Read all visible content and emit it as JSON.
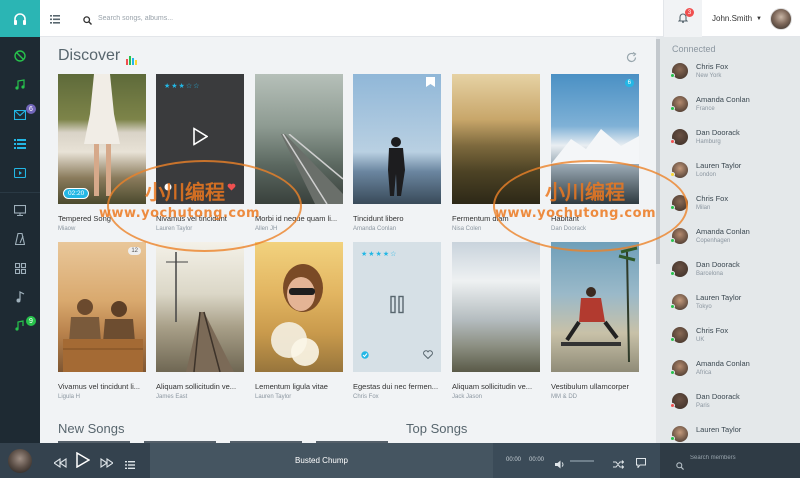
{
  "app": {
    "user_name": "John.Smith",
    "notification_count": "3",
    "search_placeholder": "Search songs, albums..."
  },
  "rail": {
    "items": [
      {
        "icon": "disc-icon",
        "badge": ""
      },
      {
        "icon": "music-note-icon",
        "badge": ""
      },
      {
        "icon": "mail-icon",
        "badge": "6"
      },
      {
        "icon": "list-icon",
        "badge": ""
      },
      {
        "icon": "video-icon",
        "badge": ""
      },
      {
        "icon": "monitor-icon",
        "badge": ""
      },
      {
        "icon": "metronome-icon",
        "badge": ""
      },
      {
        "icon": "grid-icon",
        "badge": ""
      },
      {
        "icon": "note-icon",
        "badge": ""
      },
      {
        "icon": "download-music-icon",
        "badge": "9"
      }
    ]
  },
  "main": {
    "title": "Discover",
    "cards": [
      {
        "title": "Tempered Song",
        "artist": "Miaow",
        "pill": "02:20",
        "badge": "",
        "stars": ""
      },
      {
        "title": "Nivamus vel tincidunt",
        "artist": "Lauren Taylor",
        "pill": "",
        "badge": "",
        "stars": "★★★☆☆"
      },
      {
        "title": "Morbi id neque quam li...",
        "artist": "Allen JH",
        "pill": "",
        "badge": "",
        "stars": ""
      },
      {
        "title": "Tincidunt libero",
        "artist": "Amanda Conlan",
        "pill": "",
        "badge": "",
        "stars": ""
      },
      {
        "title": "Fermentum diam",
        "artist": "Nisa Colen",
        "pill": "",
        "badge": "",
        "stars": ""
      },
      {
        "title": "Habitant",
        "artist": "Dan Doorack",
        "pill": "",
        "badge": "6",
        "stars": ""
      },
      {
        "title": "Vivamus vel tincidunt li...",
        "artist": "Ligula H",
        "pill": "",
        "badge": "12",
        "stars": ""
      },
      {
        "title": "Aliquam sollicitudin ve...",
        "artist": "James East",
        "pill": "",
        "badge": "",
        "stars": ""
      },
      {
        "title": "Lementum ligula vitae",
        "artist": "Lauren Taylor",
        "pill": "",
        "badge": "",
        "stars": ""
      },
      {
        "title": "Egestas dui nec fermen...",
        "artist": "Chris Fox",
        "pill": "",
        "badge": "",
        "stars": "★★★★☆"
      },
      {
        "title": "Aliquam sollicitudin ve...",
        "artist": "Jack Jason",
        "pill": "",
        "badge": "",
        "stars": ""
      },
      {
        "title": "Vestibulum ullamcorper",
        "artist": "MM & DD",
        "pill": "",
        "badge": "",
        "stars": ""
      }
    ],
    "new_songs_title": "New Songs",
    "top_songs_title": "Top Songs"
  },
  "connected": {
    "title": "Connected",
    "members": [
      {
        "name": "Chris Fox",
        "location": "New York",
        "status": "#27c24c"
      },
      {
        "name": "Amanda Conlan",
        "location": "France",
        "status": "#27c24c"
      },
      {
        "name": "Dan Doorack",
        "location": "Hamburg",
        "status": "#f05050"
      },
      {
        "name": "Lauren Taylor",
        "location": "London",
        "status": "#fad733"
      },
      {
        "name": "Chris Fox",
        "location": "Milan",
        "status": "#27c24c"
      },
      {
        "name": "Amanda Conlan",
        "location": "Copenhagen",
        "status": "#27c24c"
      },
      {
        "name": "Dan Doorack",
        "location": "Barcelona",
        "status": "#27c24c"
      },
      {
        "name": "Lauren Taylor",
        "location": "Tokyo",
        "status": "#27c24c"
      },
      {
        "name": "Chris Fox",
        "location": "UK",
        "status": "#27c24c"
      },
      {
        "name": "Amanda Conlan",
        "location": "Africa",
        "status": "#27c24c"
      },
      {
        "name": "Dan Doorack",
        "location": "Paris",
        "status": "#f05050"
      },
      {
        "name": "Lauren Taylor",
        "location": "",
        "status": "#27c24c"
      }
    ]
  },
  "player": {
    "song_title": "Busted Chump",
    "time_current": "00:00",
    "time_total": "00:00",
    "search_members_placeholder": "Search members"
  },
  "watermark": {
    "brand_cn": "小川编程",
    "url": "www.yochutong.com"
  },
  "colors": {
    "accent": "#2bb5b4",
    "info": "#23b7e5",
    "rail_bg": "#1e2a33",
    "player_bg": "#3b4b58"
  }
}
